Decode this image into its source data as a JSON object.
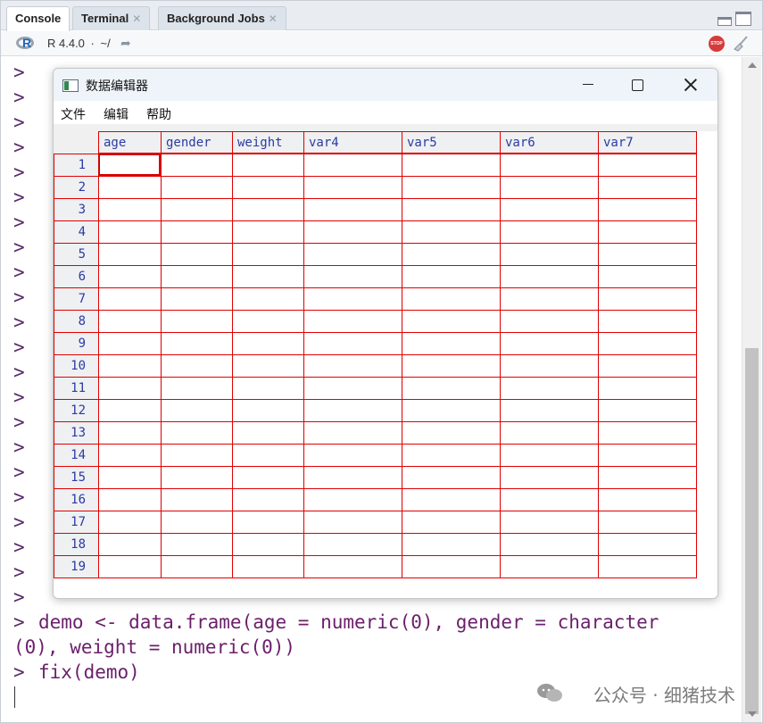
{
  "tabs": [
    {
      "label": "Console",
      "active": true,
      "closable": false
    },
    {
      "label": "Terminal",
      "active": false,
      "closable": true
    },
    {
      "label": "Background Jobs",
      "active": false,
      "closable": true
    }
  ],
  "toolbar": {
    "r_version": "R 4.4.0",
    "separator": "·",
    "working_dir": "~/",
    "stop_label": "STOP"
  },
  "console": {
    "prompt_symbol": ">",
    "empty_prompt_count": 22,
    "commands": [
      {
        "prompt": ">",
        "line1": "demo <- data.frame(age = numeric(0), gender = character",
        "line2": "(0), weight = numeric(0))"
      },
      {
        "prompt": ">",
        "line1": "fix(demo)"
      }
    ]
  },
  "editor": {
    "title": "数据编辑器",
    "menu": [
      "文件",
      "编辑",
      "帮助"
    ],
    "columns": [
      "age",
      "gender",
      "weight",
      "var4",
      "var5",
      "var6",
      "var7"
    ],
    "rows": [
      "1",
      "2",
      "3",
      "4",
      "5",
      "6",
      "7",
      "8",
      "9",
      "10",
      "11",
      "12",
      "13",
      "14",
      "15",
      "16",
      "17",
      "18",
      "19"
    ],
    "active_cell": {
      "row": "1",
      "column": "age"
    }
  },
  "watermark": "公众号 · 细猪技术",
  "colors": {
    "grid_line": "#e10000",
    "header_text": "#2c3aa3",
    "console_text": "#6b1f6b"
  }
}
